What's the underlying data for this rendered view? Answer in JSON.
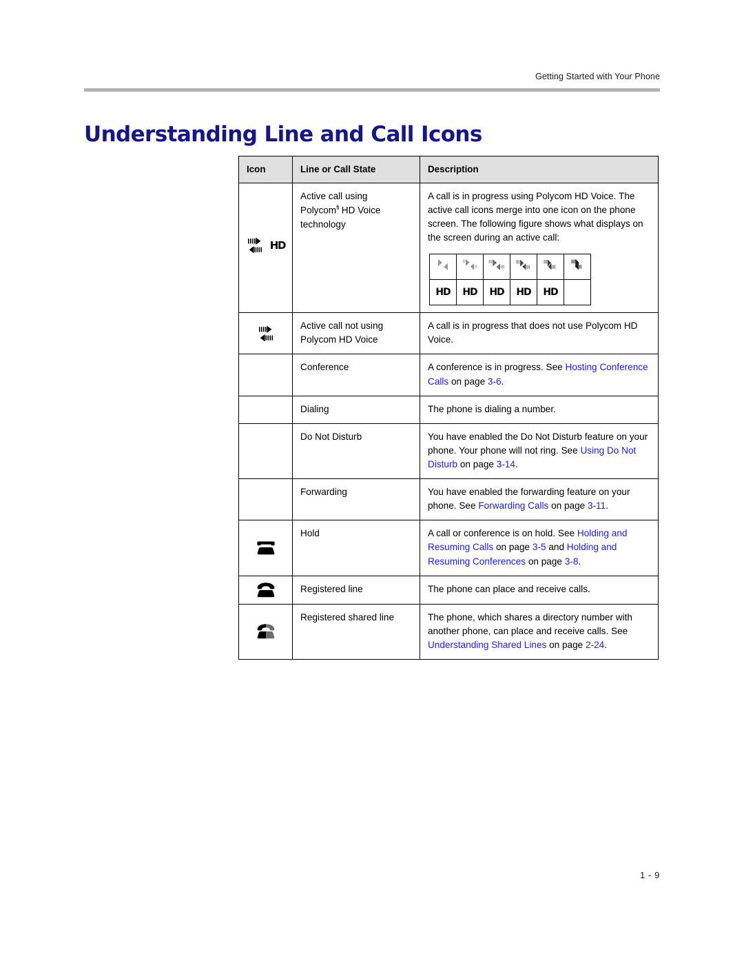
{
  "header": {
    "running_head": "Getting Started with Your Phone"
  },
  "title": "Understanding Line and Call Icons",
  "footer": {
    "page_number": "1 - 9"
  },
  "colors": {
    "title": "#16168c",
    "link": "#1a1aff",
    "header_rule": "#b3b3b3",
    "table_header_bg": "#e0e0e0",
    "border": "#000000"
  },
  "table": {
    "columns": [
      "Icon",
      "Line or Call State",
      "Description"
    ],
    "rows": [
      {
        "icon": "active-call-hd-icon",
        "state_line1": "Active call using",
        "state_line2_pre": "Polycom",
        "state_line2_sup": "fi",
        "state_line2_post": " HD Voice",
        "state_line3": "technology",
        "description": "A call is in progress using Polycom HD Voice. The active call icons merge into one icon on the phone screen. The following figure shows what displays on the screen during an active call:",
        "has_figure": true
      },
      {
        "icon": "active-call-icon",
        "state": "Active call not using Polycom HD Voice",
        "description": "A call is in progress that does not use Polycom HD Voice."
      },
      {
        "icon": "none",
        "state": "Conference",
        "desc_parts": [
          {
            "text": "A conference is in progress. See ",
            "link": false
          },
          {
            "text": "Hosting Conference Calls",
            "link": true
          },
          {
            "text": " on page ",
            "link": false
          },
          {
            "text": "3-6",
            "link": true
          },
          {
            "text": ".",
            "link": false
          }
        ]
      },
      {
        "icon": "none",
        "state": "Dialing",
        "description": "The phone is dialing a number."
      },
      {
        "icon": "none",
        "state": "Do Not Disturb",
        "desc_parts": [
          {
            "text": "You have enabled the Do Not Disturb feature on your phone. Your phone will not ring. See ",
            "link": false
          },
          {
            "text": "Using Do Not Disturb",
            "link": true
          },
          {
            "text": " on page ",
            "link": false
          },
          {
            "text": "3-14",
            "link": true
          },
          {
            "text": ".",
            "link": false
          }
        ]
      },
      {
        "icon": "none",
        "state": "Forwarding",
        "desc_parts": [
          {
            "text": "You have enabled the forwarding feature on your phone. See ",
            "link": false
          },
          {
            "text": "Forwarding Calls",
            "link": true
          },
          {
            "text": " on page ",
            "link": false
          },
          {
            "text": "3-11",
            "link": true
          },
          {
            "text": ".",
            "link": false
          }
        ]
      },
      {
        "icon": "hold-phone-icon",
        "state": "Hold",
        "desc_parts": [
          {
            "text": "A call or conference is on hold. See ",
            "link": false
          },
          {
            "text": "Holding and Resuming Calls",
            "link": true
          },
          {
            "text": " on page ",
            "link": false
          },
          {
            "text": "3-5",
            "link": true
          },
          {
            "text": " and ",
            "link": false
          },
          {
            "text": "Holding and Resuming Conferences",
            "link": true
          },
          {
            "text": " on page ",
            "link": false
          },
          {
            "text": "3-8",
            "link": true
          },
          {
            "text": ".",
            "link": false
          }
        ]
      },
      {
        "icon": "registered-line-phone-icon",
        "state": "Registered line",
        "description": "The phone can place and receive calls."
      },
      {
        "icon": "registered-shared-line-phone-icon",
        "state": "Registered shared line",
        "desc_parts": [
          {
            "text": "The phone, which shares a directory number with another phone, can place and receive calls. See ",
            "link": false
          },
          {
            "text": "Understanding Shared Lines",
            "link": true
          },
          {
            "text": " on page ",
            "link": false
          },
          {
            "text": "2-24",
            "link": true
          },
          {
            "text": ".",
            "link": false
          }
        ]
      }
    ]
  },
  "merge_figure": {
    "caption_ref": "active call icon merge sequence",
    "columns": 6,
    "rows": 2,
    "top_row_frames": [
      "arrows-far-apart",
      "arrows-approaching",
      "arrows-closer",
      "arrows-near-merge",
      "arrows-overlapping",
      "arrows-merged"
    ],
    "bottom_row_labels": [
      "HD",
      "HD",
      "HD",
      "HD",
      "HD",
      ""
    ]
  }
}
